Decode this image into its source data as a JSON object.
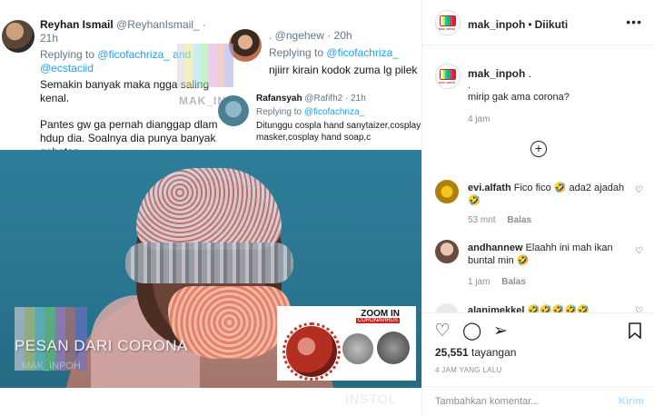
{
  "tweets": {
    "t1": {
      "name": "Reyhan Ismail",
      "handle": "@ReyhanIsmail_ · 21h",
      "replying": "Replying to",
      "to1": "@ficofachriza_",
      "and": "and",
      "to2": "@ecstaciid",
      "line1": "Semakin banyak maka ngga saling",
      "line2": "kenal.",
      "line3": "Pantes gw ga pernah dianggap dlam",
      "line4": "hdup dia. Soalnya dia punya banyak",
      "line5": "gebetan."
    },
    "t2": {
      "handle": ". @ngehew · 20h",
      "replying": "Replying to",
      "to": "@ficofachriza_",
      "text": "njiirr kirain kodok zuma lg pilek"
    },
    "t3": {
      "name": "Rafansyah",
      "handle": "@Rafifh2 · 21h",
      "replying": "Replying to",
      "to": "@ficofachriza_",
      "line1": "Ditunggu cospla hand sanytaizer,cosplay",
      "line2": "masker,cosplay hand soap,c"
    },
    "watermark": "MAK_INP"
  },
  "overlay": {
    "pesan": "PESAN DARI CORONA",
    "small_mark": "MAK_INPOH",
    "zoom_title": "ZOOM IN",
    "zoom_sub": "CORONAVIRUS",
    "bottom_mark": "INSTOL"
  },
  "header": {
    "username": "mak_inpoh",
    "dot": "•",
    "follow": "Diikuti",
    "more": "•••",
    "avatar_brand": "MAK_INPOH"
  },
  "caption": {
    "username": "mak_inpoh",
    "suffix": ".",
    "line1": ".",
    "line2": "mirip gak ama corona?",
    "time": "4 jam"
  },
  "comments": [
    {
      "user": "evi.alfath",
      "text": "Fico fico 🤣 ada2 ajadah",
      "text2": "🤣",
      "time": "53 mnt",
      "reply": "Balas"
    },
    {
      "user": "andhannew",
      "text": "Elaahh ini mah ikan",
      "text2": "buntal min 🤣",
      "time": "1 jam",
      "reply": "Balas"
    },
    {
      "user": "alanimekkel",
      "text": "🤣🤣🤣🤣🤣",
      "text2": "",
      "time": "",
      "reply": ""
    }
  ],
  "actions": {
    "like_icon": "heart-icon",
    "comment_icon": "comment-icon",
    "share_icon": "share-icon",
    "save_icon": "bookmark-icon",
    "views_count": "25,551",
    "views_label": "tayangan",
    "posted": "4 JAM YANG LALU"
  },
  "comment_box": {
    "placeholder": "Tambahkan komentar...",
    "post_label": "Kirim"
  },
  "colors": {
    "link": "#1da1f2",
    "post_disabled": "#b2dffc",
    "muted": "#8e8e8e",
    "text": "#262626"
  }
}
